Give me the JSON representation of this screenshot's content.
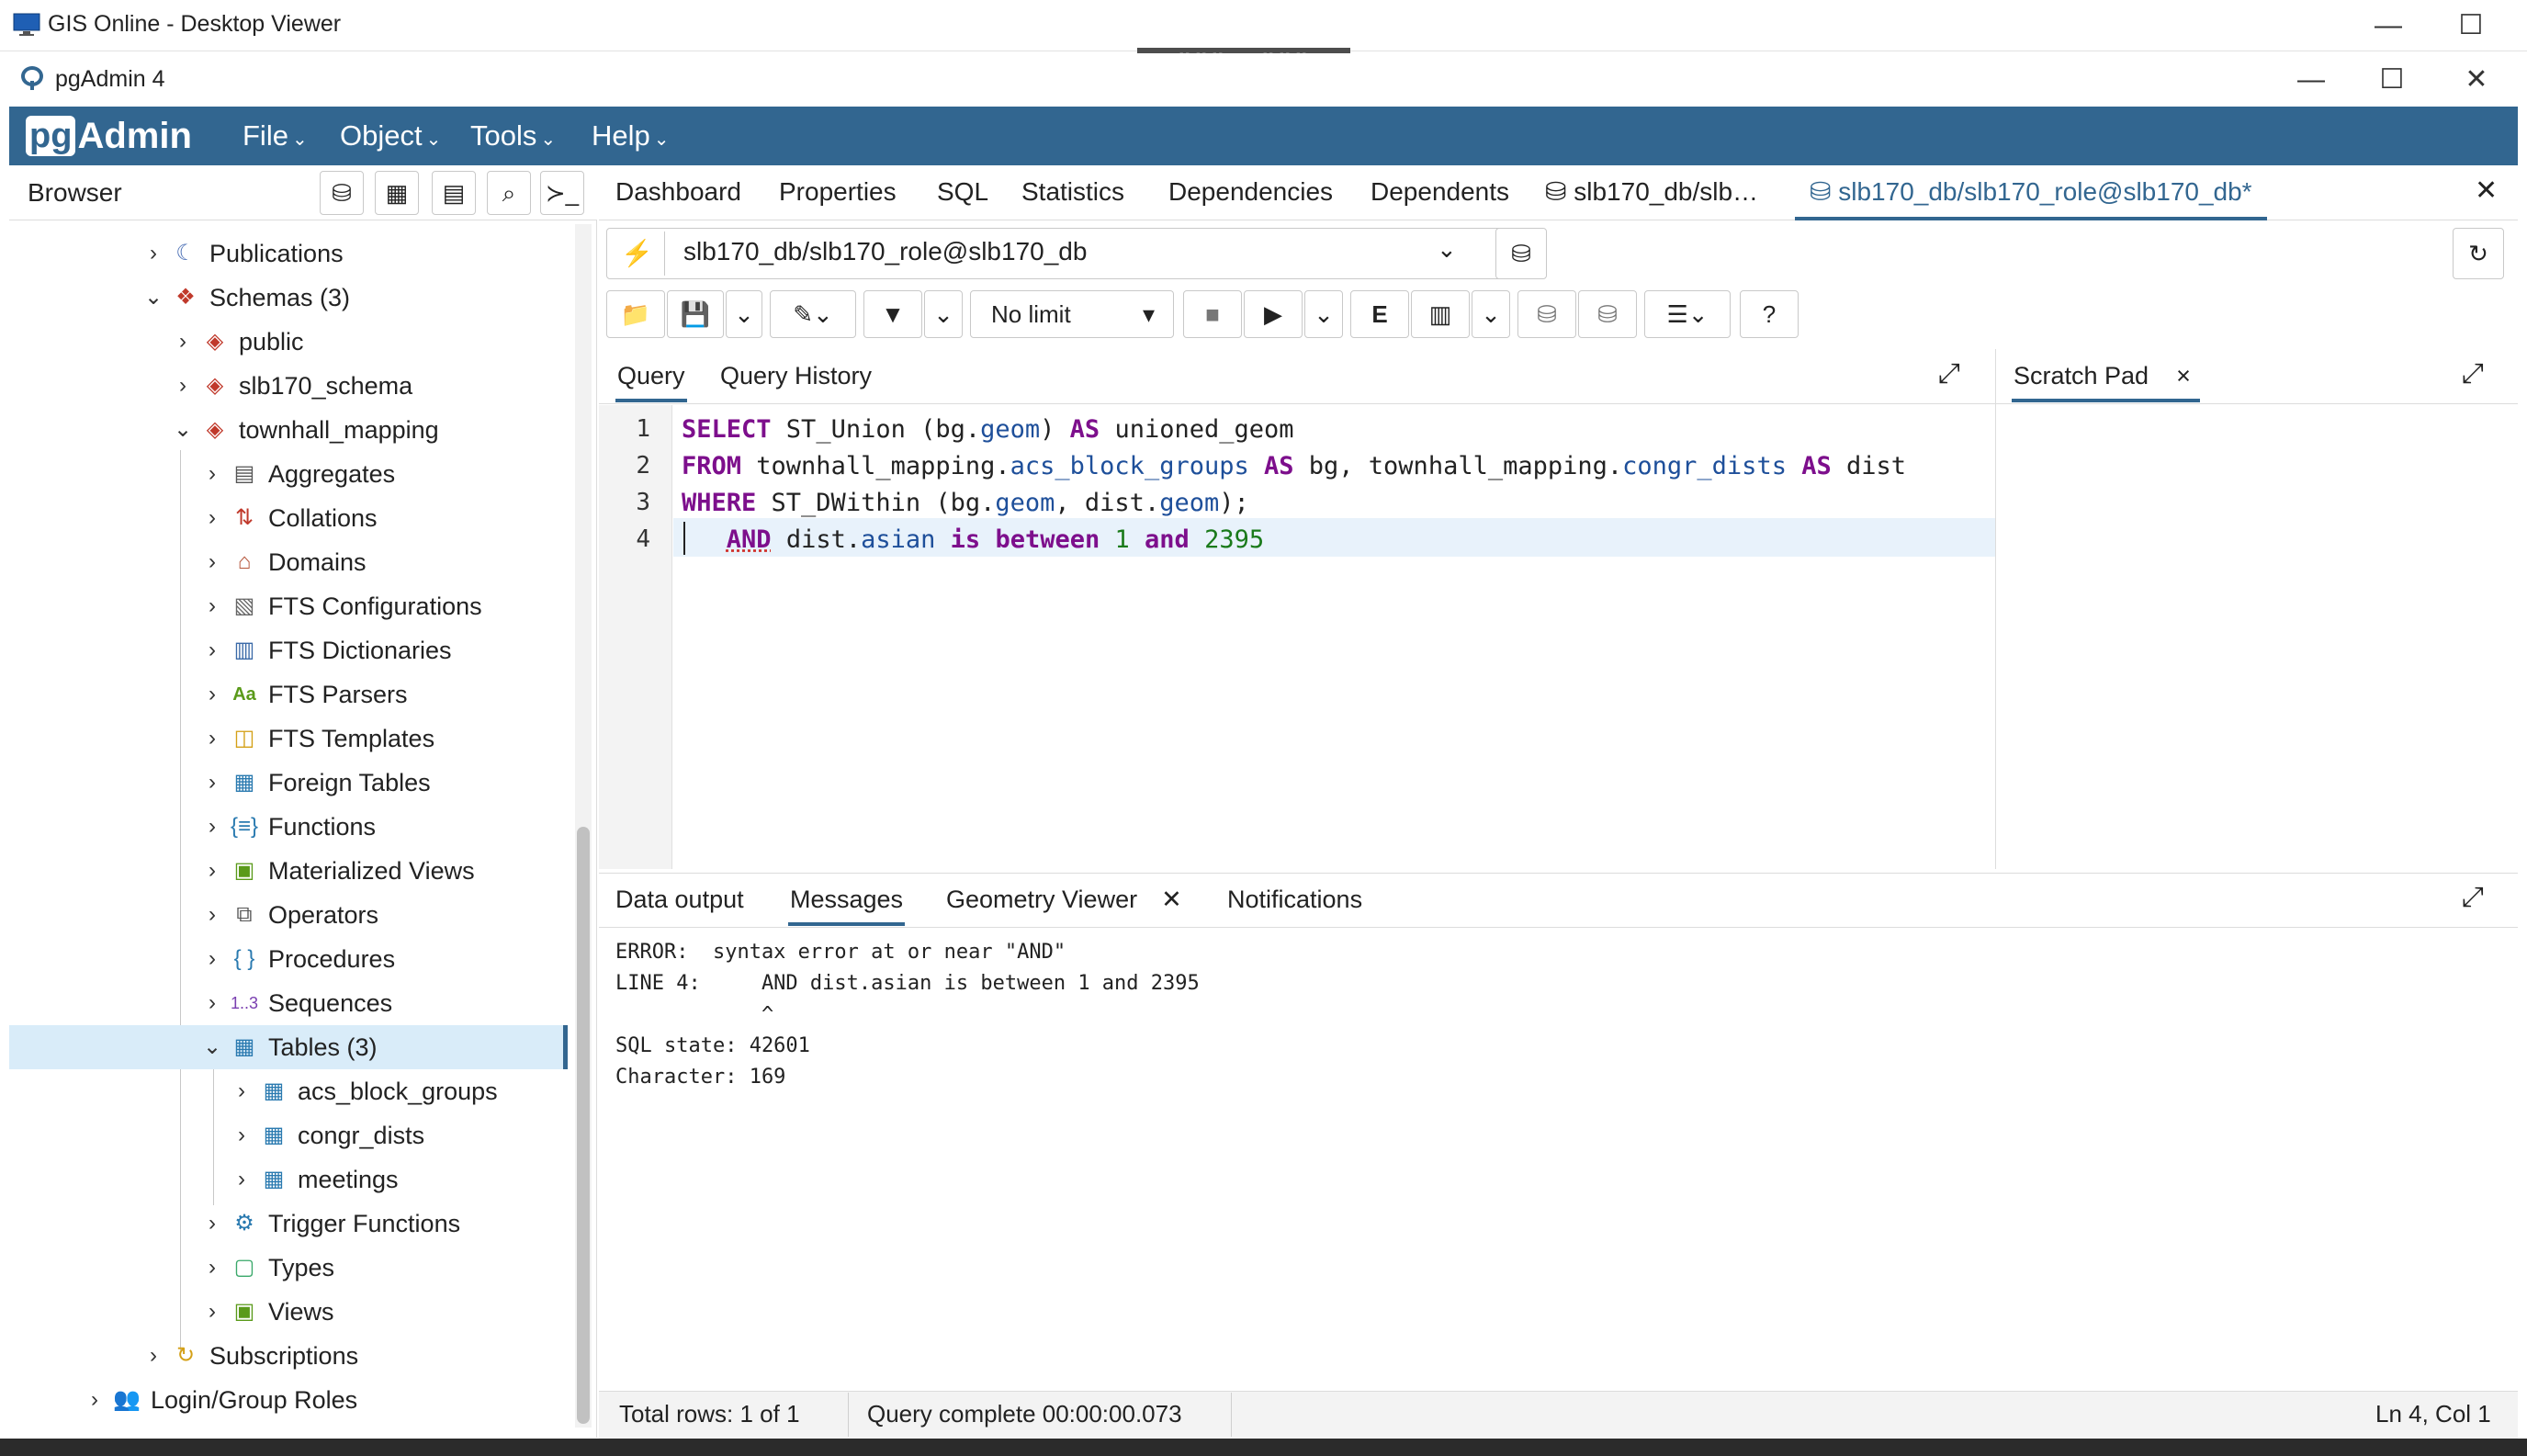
{
  "outer_window": {
    "title": "GIS Online - Desktop Viewer",
    "minimize": "—",
    "maximize": "☐"
  },
  "drag_handle": "⠿⠿⠿ ⬇ ⠿⠿⠿",
  "pgadmin_window": {
    "title": "pgAdmin 4",
    "minimize": "—",
    "maximize": "☐",
    "close": "✕"
  },
  "logo": {
    "pg": "pg",
    "admin": "Admin"
  },
  "menu": [
    {
      "label": "File"
    },
    {
      "label": "Object"
    },
    {
      "label": "Tools"
    },
    {
      "label": "Help"
    }
  ],
  "browser": {
    "title": "Browser",
    "tree": [
      {
        "label": "Publications",
        "chevron": "›"
      },
      {
        "label": "Schemas (3)",
        "chevron": "⌄"
      },
      {
        "label": "public",
        "chevron": "›"
      },
      {
        "label": "slb170_schema",
        "chevron": "›"
      },
      {
        "label": "townhall_mapping",
        "chevron": "⌄"
      },
      {
        "label": "Aggregates",
        "chevron": "›"
      },
      {
        "label": "Collations",
        "chevron": "›"
      },
      {
        "label": "Domains",
        "chevron": "›"
      },
      {
        "label": "FTS Configurations",
        "chevron": "›"
      },
      {
        "label": "FTS Dictionaries",
        "chevron": "›"
      },
      {
        "label": "FTS Parsers",
        "chevron": "›"
      },
      {
        "label": "FTS Templates",
        "chevron": "›"
      },
      {
        "label": "Foreign Tables",
        "chevron": "›"
      },
      {
        "label": "Functions",
        "chevron": "›"
      },
      {
        "label": "Materialized Views",
        "chevron": "›"
      },
      {
        "label": "Operators",
        "chevron": "›"
      },
      {
        "label": "Procedures",
        "chevron": "›"
      },
      {
        "label": "Sequences",
        "chevron": "›"
      },
      {
        "label": "Tables (3)",
        "chevron": "⌄"
      },
      {
        "label": "acs_block_groups",
        "chevron": "›"
      },
      {
        "label": "congr_dists",
        "chevron": "›"
      },
      {
        "label": "meetings",
        "chevron": "›"
      },
      {
        "label": "Trigger Functions",
        "chevron": "›"
      },
      {
        "label": "Types",
        "chevron": "›"
      },
      {
        "label": "Views",
        "chevron": "›"
      },
      {
        "label": "Subscriptions",
        "chevron": "›"
      },
      {
        "label": "Login/Group Roles",
        "chevron": "›"
      }
    ]
  },
  "top_tabs": [
    {
      "label": "Dashboard"
    },
    {
      "label": "Properties"
    },
    {
      "label": "SQL"
    },
    {
      "label": "Statistics"
    },
    {
      "label": "Dependencies"
    },
    {
      "label": "Dependents"
    },
    {
      "label": "slb170_db/slb…"
    },
    {
      "label": "slb170_db/slb170_role@slb170_db*"
    }
  ],
  "connection": {
    "value": "slb170_db/slb170_role@slb170_db"
  },
  "toolbar": {
    "limit": "No limit"
  },
  "query_tabs": [
    {
      "label": "Query"
    },
    {
      "label": "Query History"
    }
  ],
  "scratch_pad": {
    "label": "Scratch Pad",
    "close": "×"
  },
  "editor": {
    "line_numbers": [
      "1",
      "2",
      "3",
      "4"
    ]
  },
  "result_tabs": [
    {
      "label": "Data output"
    },
    {
      "label": "Messages"
    },
    {
      "label": "Geometry Viewer"
    },
    {
      "label": "Notifications"
    }
  ],
  "messages": [
    "ERROR:  syntax error at or near \"AND\"",
    "LINE 4:     AND dist.asian is between 1 and 2395",
    "            ^",
    "SQL state: 42601",
    "Character: 169"
  ],
  "status": {
    "rows": "Total rows: 1 of 1",
    "query": "Query complete 00:00:00.073",
    "cursor": "Ln 4, Col 1"
  },
  "colors": {
    "brand": "#326690",
    "keyword": "#7d0f8c",
    "identifier": "#1e4f9a",
    "selected_row": "#d9ecf9"
  }
}
